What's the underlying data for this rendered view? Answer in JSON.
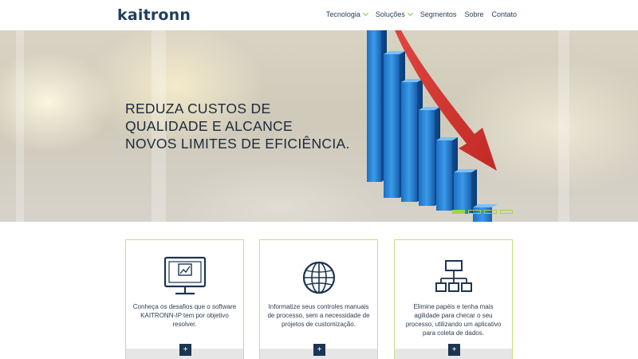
{
  "brand": {
    "logo_text": "kaitronn",
    "accent": "#9cc83b",
    "primary": "#1e3f5e"
  },
  "nav": {
    "items": [
      {
        "label": "Tecnologia",
        "dropdown": true
      },
      {
        "label": "Soluções",
        "dropdown": true
      },
      {
        "label": "Segmentos",
        "dropdown": false
      },
      {
        "label": "Sobre",
        "dropdown": false
      },
      {
        "label": "Contato",
        "dropdown": false
      }
    ]
  },
  "hero": {
    "line1": "REDUZA CUSTOS DE",
    "line2": "QUALIDADE E ALCANCE",
    "line3": "NOVOS LIMITES DE EFICIÊNCIA.",
    "slide_count": 4,
    "active_slide": 1
  },
  "cards": [
    {
      "icon": "monitor-chart-icon",
      "text_a": "Conheça os desafios que o software",
      "text_b": "KAITRONN-",
      "text_b_em": "IP",
      "text_b_rest": " tem por objetivo",
      "text_c": "resolver.",
      "button": "+"
    },
    {
      "icon": "globe-icon",
      "text_a": "Informatize seus controles manuais",
      "text_b": "de processo, sem a necessidade de",
      "text_c": "projetos de customização.",
      "button": "+"
    },
    {
      "icon": "org-chart-icon",
      "text_a": "Elimine papéis e tenha mais",
      "text_b": "agilidade para checar o seu",
      "text_c": "processo, utilizando um aplicativo",
      "text_d": "para coleta de dados.",
      "button": "+"
    }
  ]
}
